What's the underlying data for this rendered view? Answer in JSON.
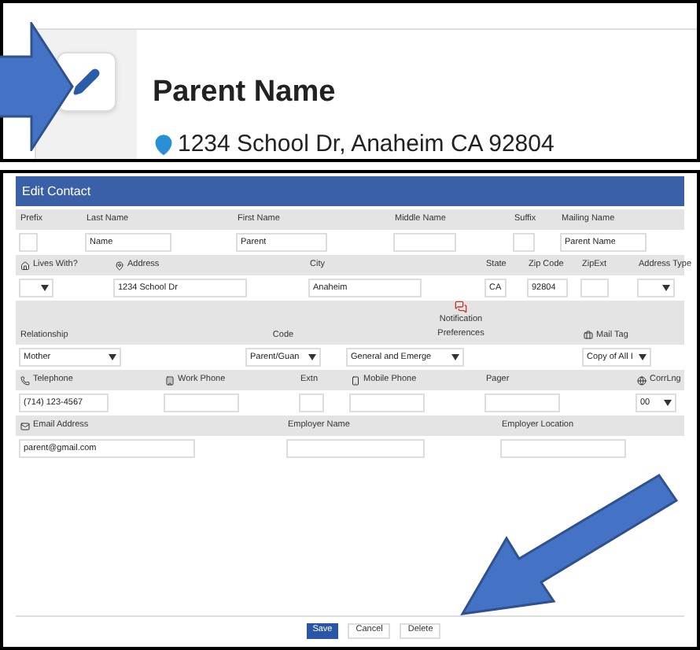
{
  "contact_card": {
    "name": "Parent Name",
    "address": "1234 School Dr, Anaheim CA 92804"
  },
  "dialog": {
    "title": "Edit Contact",
    "rows": [
      {
        "fields": [
          {
            "label": "Prefix",
            "kind": "text"
          },
          {
            "label": "Last Name",
            "kind": "text",
            "value": "Name"
          },
          {
            "label": "First Name",
            "kind": "text",
            "value": "Parent"
          },
          {
            "label": "Middle Name",
            "kind": "text"
          },
          {
            "label": "Suffix",
            "kind": "text"
          },
          {
            "label": "Mailing Name",
            "kind": "text",
            "value": "Parent Name"
          }
        ]
      },
      {
        "fields": [
          {
            "label": "Lives With?",
            "kind": "select"
          },
          {
            "label": "Address",
            "kind": "text",
            "value": "1234 School Dr"
          },
          {
            "label": "City",
            "kind": "text",
            "value": "Anaheim"
          },
          {
            "label": "State",
            "kind": "text",
            "value": "CA"
          },
          {
            "label": "Zip Code",
            "kind": "text",
            "value": "92804"
          },
          {
            "label": "ZipExt",
            "kind": "text"
          },
          {
            "label": "Address Type",
            "kind": "select"
          }
        ]
      },
      {
        "fields": [
          {
            "label": "Relationship",
            "kind": "select",
            "value": "Mother"
          },
          {
            "label": "Code",
            "kind": "select",
            "value": "Parent/Guan"
          },
          {
            "label": "Notification Preferences",
            "kind": "select",
            "value": "General and Emerge"
          },
          {
            "label": "Mail Tag",
            "kind": "select",
            "value": "Copy of All I"
          }
        ]
      },
      {
        "fields": [
          {
            "label": "Telephone",
            "kind": "text",
            "value": "(714) 123-4567"
          },
          {
            "label": "Work Phone",
            "kind": "text"
          },
          {
            "label": "Extn",
            "kind": "text"
          },
          {
            "label": "Mobile Phone",
            "kind": "text"
          },
          {
            "label": "Pager",
            "kind": "text"
          },
          {
            "label": "CorrLng",
            "kind": "select",
            "value": "00"
          }
        ]
      },
      {
        "fields": [
          {
            "label": "Email Address",
            "kind": "text",
            "value": "parent@gmail.com"
          },
          {
            "label": "Employer Name",
            "kind": "text"
          },
          {
            "label": "Employer Location",
            "kind": "text"
          }
        ]
      }
    ],
    "buttons": [
      {
        "label": "Save",
        "kind": "primary"
      },
      {
        "label": "Cancel",
        "kind": "secondary"
      },
      {
        "label": "Delete",
        "kind": "secondary"
      }
    ]
  }
}
